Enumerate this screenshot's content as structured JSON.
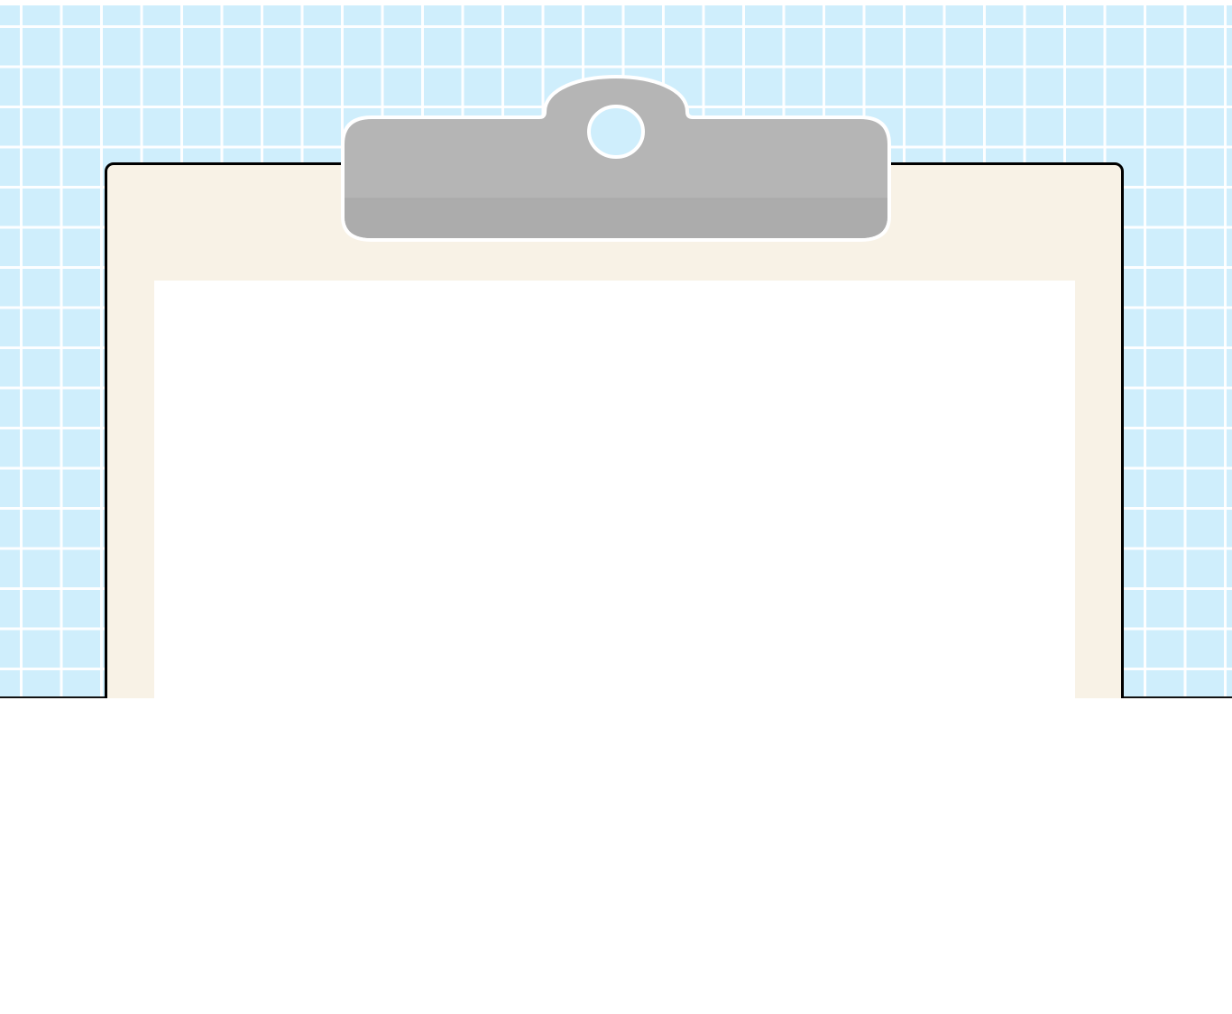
{
  "scene": {
    "background_color": "#cfeefc",
    "grid_line_color": "#ffffff",
    "board_color": "#f8f2e6",
    "paper_color": "#ffffff",
    "clip_color": "#b5b5b5",
    "clip_shadow_color": "#acacac",
    "border_color": "#000000"
  },
  "icons": {
    "clip": "clipboard-clip-icon",
    "clip_hole": "ring-hole-icon"
  }
}
